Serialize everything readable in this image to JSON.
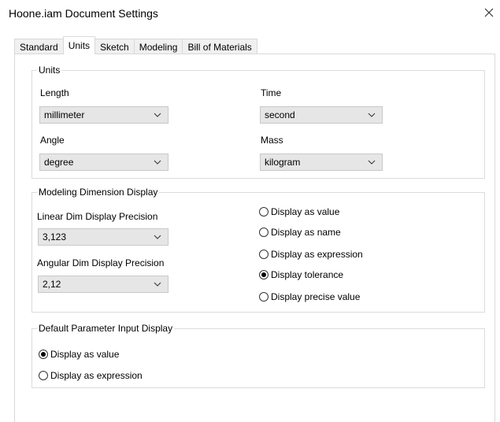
{
  "window": {
    "title": "Hoone.iam Document Settings"
  },
  "tabs": [
    {
      "label": "Standard",
      "active": false
    },
    {
      "label": "Units",
      "active": true
    },
    {
      "label": "Sketch",
      "active": false
    },
    {
      "label": "Modeling",
      "active": false
    },
    {
      "label": "Bill of Materials",
      "active": false
    }
  ],
  "units": {
    "legend": "Units",
    "length_label": "Length",
    "length_value": "millimeter",
    "time_label": "Time",
    "time_value": "second",
    "angle_label": "Angle",
    "angle_value": "degree",
    "mass_label": "Mass",
    "mass_value": "kilogram"
  },
  "modeling_display": {
    "legend": "Modeling Dimension Display",
    "linear_label": "Linear Dim Display Precision",
    "linear_value": "3,123",
    "angular_label": "Angular Dim Display Precision",
    "angular_value": "2,12",
    "options": [
      {
        "label": "Display as value",
        "selected": false
      },
      {
        "label": "Display as name",
        "selected": false
      },
      {
        "label": "Display as expression",
        "selected": false
      },
      {
        "label": "Display tolerance",
        "selected": true
      },
      {
        "label": "Display precise value",
        "selected": false
      }
    ]
  },
  "parameter_input": {
    "legend": "Default Parameter Input Display",
    "options": [
      {
        "label": "Display as value",
        "selected": true
      },
      {
        "label": "Display as expression",
        "selected": false
      }
    ]
  }
}
